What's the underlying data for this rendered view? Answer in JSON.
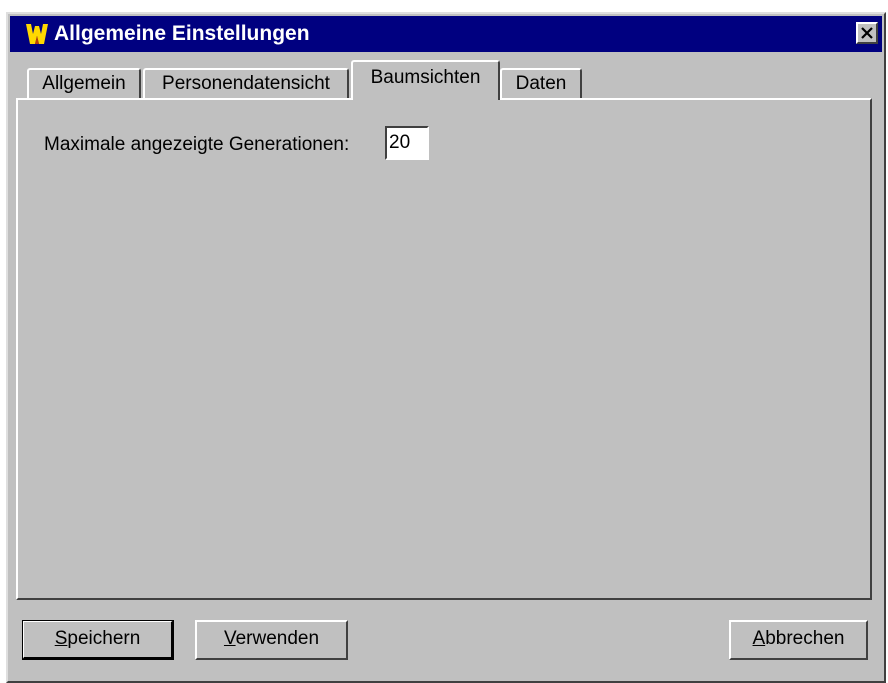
{
  "window": {
    "title": "Allgemeine Einstellungen",
    "icon": "w-app-icon",
    "close_icon": "close-icon"
  },
  "tabs": [
    {
      "label": "Allgemein",
      "active": false
    },
    {
      "label": "Personendatensicht",
      "active": false
    },
    {
      "label": "Baumsichten",
      "active": true
    },
    {
      "label": "Daten",
      "active": false
    }
  ],
  "panel": {
    "max_generations_label": "Maximale angezeigte Generationen:",
    "max_generations_value": "20"
  },
  "buttons": {
    "save": {
      "first": "S",
      "rest": "peichern"
    },
    "apply": {
      "first": "V",
      "rest": "erwenden"
    },
    "cancel": {
      "first": "A",
      "rest": "bbrechen"
    }
  },
  "colors": {
    "titlebar": "#000080",
    "face": "#c0c0c0",
    "icon": "#ffd800"
  }
}
